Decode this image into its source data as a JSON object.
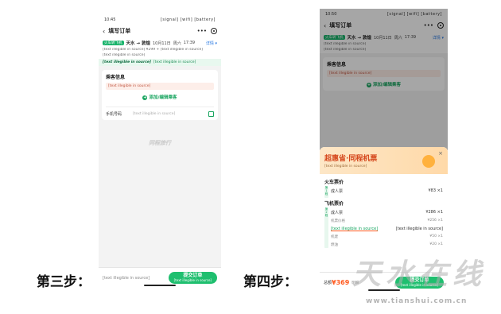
{
  "step3_label": "第三步：",
  "step4_label": "第四步：",
  "watermark_big": "天水在线",
  "watermark_url": "www.tianshui.com.cn",
  "phone1": {
    "time": "10:45",
    "status_icons": "[signal] [wifi] [battery]",
    "title": "填写订单",
    "more": "•••",
    "trip": {
      "tag": "火车转飞机",
      "route": "天水 → 敦煌",
      "date": "10月11日",
      "weekday": "周六",
      "time": "17:39",
      "detail": "详情 ▾",
      "line1": "[text illegible in source] ¥299 + [text illegible in source]",
      "line2": "[text illegible in source]"
    },
    "member_name": "[text illegible in source]",
    "member_text": "[text illegible in source]",
    "passenger_title": "乘客信息",
    "notice": "[text illegible in source]",
    "add_passenger": "添加/编辑乘客",
    "phone_label": "手机号码",
    "phone_placeholder": "[text illegible in source]",
    "brand_watermark": "同程旅行",
    "bottom_hint": "[text illegible in source]",
    "submit": "提交订单",
    "submit_sub": "[text illegible in source]"
  },
  "phone2": {
    "time": "10:50",
    "status_icons": "[signal] [wifi] [battery]",
    "title": "填写订单",
    "more": "•••",
    "trip": {
      "tag": "火车转飞机",
      "route": "天水 → 敦煌",
      "date": "10月11日",
      "weekday": "周六",
      "time": "17:39",
      "detail": "详情 ▾",
      "line1": "[text illegible in source]",
      "line2": "[text illegible in source]"
    },
    "passenger_title": "乘客信息",
    "notice": "[text illegible in source]",
    "add_passenger": "添加/编辑乘客",
    "banner_title": "超惠省·同程机票",
    "banner_sub": "[text illegible in source]",
    "close": "×",
    "train_section": "火车票价",
    "train_side_tag": "第1程",
    "train_rows": [
      {
        "name": "成人票",
        "price": "¥83 ×1"
      }
    ],
    "flight_section": "飞机票价",
    "flight_side_tag": "第2程",
    "flight_rows": [
      {
        "name": "成人票",
        "price": "¥286 ×1",
        "kind": "main"
      },
      {
        "name": "机票价格",
        "price": "¥256 ×1",
        "kind": "sub"
      },
      {
        "name": "[text illegible in source]",
        "price": "[text illegible in source]",
        "kind": "link"
      },
      {
        "name": "机建",
        "price": "¥50 ×1",
        "kind": "sub"
      },
      {
        "name": "燃油",
        "price": "¥20 ×1",
        "kind": "sub"
      }
    ],
    "total_label": "总额",
    "total_price": "¥369",
    "detail": "明细",
    "submit": "提交订单",
    "submit_sub": "[text illegible in source]"
  }
}
